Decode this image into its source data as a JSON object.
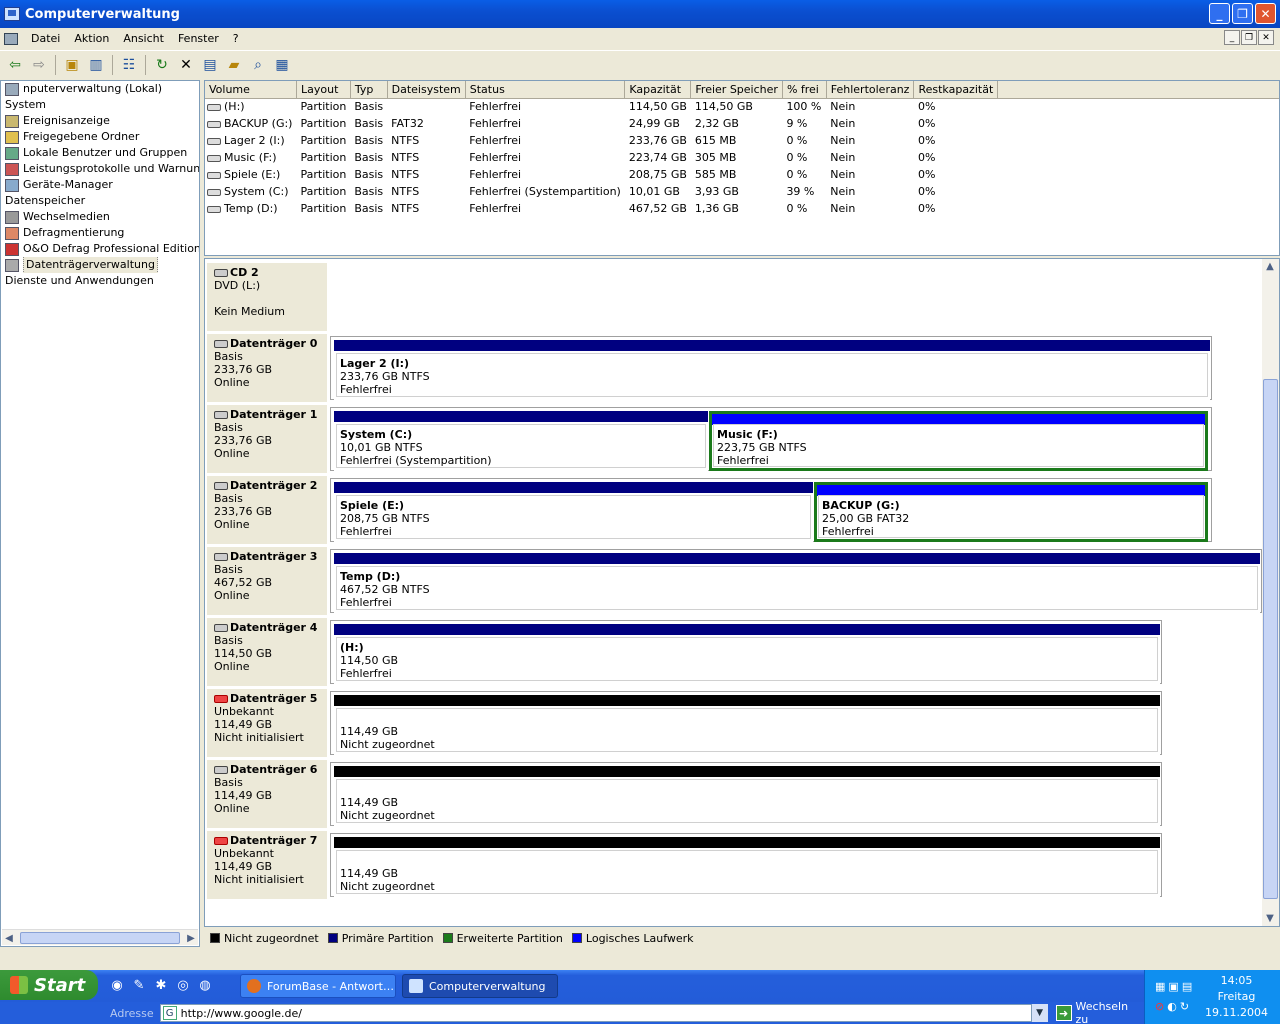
{
  "window": {
    "title": "Computerverwaltung"
  },
  "menu": [
    "Datei",
    "Aktion",
    "Ansicht",
    "Fenster",
    "?"
  ],
  "tree": [
    {
      "label": "nputerverwaltung (Lokal)",
      "icon": "computer-icon",
      "indent": 0
    },
    {
      "label": "System",
      "icon": "",
      "indent": 0
    },
    {
      "label": "Ereignisanzeige",
      "icon": "event-viewer-icon",
      "indent": 1
    },
    {
      "label": "Freigegebene Ordner",
      "icon": "shared-folder-icon",
      "indent": 1
    },
    {
      "label": "Lokale Benutzer und Gruppen",
      "icon": "users-icon",
      "indent": 1
    },
    {
      "label": "Leistungsprotokolle und Warnungen",
      "icon": "performance-icon",
      "indent": 1
    },
    {
      "label": "Geräte-Manager",
      "icon": "device-manager-icon",
      "indent": 1
    },
    {
      "label": "Datenspeicher",
      "icon": "",
      "indent": 0
    },
    {
      "label": "Wechselmedien",
      "icon": "removable-media-icon",
      "indent": 1
    },
    {
      "label": "Defragmentierung",
      "icon": "defrag-icon",
      "indent": 1
    },
    {
      "label": "O&O Defrag Professional Edition",
      "icon": "oo-defrag-icon",
      "indent": 1
    },
    {
      "label": "Datenträgerverwaltung",
      "icon": "disk-management-icon",
      "indent": 1,
      "selected": true
    },
    {
      "label": "Dienste und Anwendungen",
      "icon": "",
      "indent": 0
    }
  ],
  "volumes": {
    "columns": [
      "Volume",
      "Layout",
      "Typ",
      "Dateisystem",
      "Status",
      "Kapazität",
      "Freier Speicher",
      "% frei",
      "Fehlertoleranz",
      "Restkapazität"
    ],
    "rows": [
      [
        "(H:)",
        "Partition",
        "Basis",
        "",
        "Fehlerfrei",
        "114,50 GB",
        "114,50 GB",
        "100 %",
        "Nein",
        "0%"
      ],
      [
        "BACKUP (G:)",
        "Partition",
        "Basis",
        "FAT32",
        "Fehlerfrei",
        "24,99 GB",
        "2,32 GB",
        "9 %",
        "Nein",
        "0%"
      ],
      [
        "Lager 2 (I:)",
        "Partition",
        "Basis",
        "NTFS",
        "Fehlerfrei",
        "233,76 GB",
        "615 MB",
        "0 %",
        "Nein",
        "0%"
      ],
      [
        "Music (F:)",
        "Partition",
        "Basis",
        "NTFS",
        "Fehlerfrei",
        "223,74 GB",
        "305 MB",
        "0 %",
        "Nein",
        "0%"
      ],
      [
        "Spiele (E:)",
        "Partition",
        "Basis",
        "NTFS",
        "Fehlerfrei",
        "208,75 GB",
        "585 MB",
        "0 %",
        "Nein",
        "0%"
      ],
      [
        "System (C:)",
        "Partition",
        "Basis",
        "NTFS",
        "Fehlerfrei (Systempartition)",
        "10,01 GB",
        "3,93 GB",
        "39 %",
        "Nein",
        "0%"
      ],
      [
        "Temp (D:)",
        "Partition",
        "Basis",
        "NTFS",
        "Fehlerfrei",
        "467,52 GB",
        "1,36 GB",
        "0 %",
        "Nein",
        "0%"
      ]
    ]
  },
  "cd": {
    "name": "CD 2",
    "line1": "DVD (L:)",
    "line2": "Kein Medium"
  },
  "disks": [
    {
      "name": "Datenträger 0",
      "type": "Basis",
      "size": "233,76 GB",
      "state": "Online",
      "warn": false,
      "parts": [
        {
          "title": "Lager 2  (I:)",
          "size": "233,76 GB NTFS",
          "status": "Fehlerfrei",
          "kind": "primary"
        }
      ]
    },
    {
      "name": "Datenträger 1",
      "type": "Basis",
      "size": "233,76 GB",
      "state": "Online",
      "warn": false,
      "parts": [
        {
          "title": "System  (C:)",
          "size": "10,01 GB NTFS",
          "status": "Fehlerfrei (Systempartition)",
          "kind": "primary"
        },
        {
          "title": "Music  (F:)",
          "size": "223,75 GB NTFS",
          "status": "Fehlerfrei",
          "kind": "logical"
        }
      ]
    },
    {
      "name": "Datenträger 2",
      "type": "Basis",
      "size": "233,76 GB",
      "state": "Online",
      "warn": false,
      "parts": [
        {
          "title": "Spiele  (E:)",
          "size": "208,75 GB NTFS",
          "status": "Fehlerfrei",
          "kind": "primary"
        },
        {
          "title": "BACKUP  (G:)",
          "size": "25,00 GB FAT32",
          "status": "Fehlerfrei",
          "kind": "logical"
        }
      ]
    },
    {
      "name": "Datenträger 3",
      "type": "Basis",
      "size": "467,52 GB",
      "state": "Online",
      "warn": false,
      "parts": [
        {
          "title": "Temp  (D:)",
          "size": "467,52 GB NTFS",
          "status": "Fehlerfrei",
          "kind": "primary"
        }
      ]
    },
    {
      "name": "Datenträger 4",
      "type": "Basis",
      "size": "114,50 GB",
      "state": "Online",
      "warn": false,
      "parts": [
        {
          "title": " (H:)",
          "size": "114,50 GB",
          "status": "Fehlerfrei",
          "kind": "primary"
        }
      ]
    },
    {
      "name": "Datenträger 5",
      "type": "Unbekannt",
      "size": "114,49 GB",
      "state": "Nicht initialisiert",
      "warn": true,
      "parts": [
        {
          "title": "",
          "size": "114,49 GB",
          "status": "Nicht zugeordnet",
          "kind": "unallocated"
        }
      ]
    },
    {
      "name": "Datenträger 6",
      "type": "Basis",
      "size": "114,49 GB",
      "state": "Online",
      "warn": false,
      "parts": [
        {
          "title": "",
          "size": "114,49 GB",
          "status": "Nicht zugeordnet",
          "kind": "unallocated"
        }
      ]
    },
    {
      "name": "Datenträger 7",
      "type": "Unbekannt",
      "size": "114,49 GB",
      "state": "Nicht initialisiert",
      "warn": true,
      "parts": [
        {
          "title": "",
          "size": "114,49 GB",
          "status": "Nicht zugeordnet",
          "kind": "unallocated"
        }
      ]
    }
  ],
  "legend": [
    {
      "label": "Nicht zugeordnet",
      "color": "#000000"
    },
    {
      "label": "Primäre Partition",
      "color": "#000080"
    },
    {
      "label": "Erweiterte Partition",
      "color": "#1b7a1b"
    },
    {
      "label": "Logisches Laufwerk",
      "color": "#0000ff"
    }
  ],
  "colors": {
    "primary": "#000080",
    "logical": "#0000ff",
    "unallocated": "#000000",
    "extended": "#1b7a1b"
  },
  "taskbar": {
    "start": "Start",
    "tasks": [
      {
        "label": "ForumBase - Antwort…",
        "active": false
      },
      {
        "label": "Computerverwaltung",
        "active": true
      }
    ],
    "address_label": "Adresse",
    "address_value": "http://www.google.de/",
    "go_label": "Wechseln zu",
    "clock": {
      "time": "14:05",
      "day": "Freitag",
      "date": "19.11.2004"
    }
  }
}
